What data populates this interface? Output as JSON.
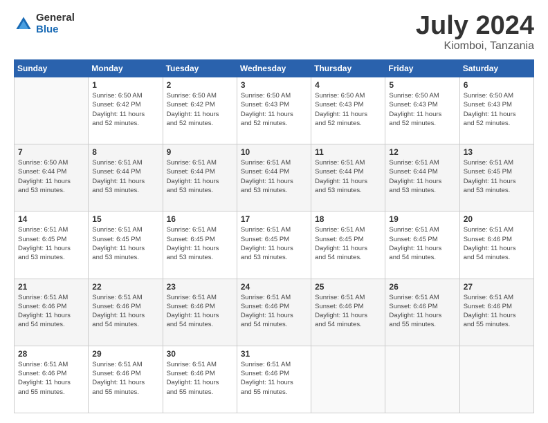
{
  "logo": {
    "general": "General",
    "blue": "Blue"
  },
  "title": {
    "month_year": "July 2024",
    "location": "Kiomboi, Tanzania"
  },
  "weekdays": [
    "Sunday",
    "Monday",
    "Tuesday",
    "Wednesday",
    "Thursday",
    "Friday",
    "Saturday"
  ],
  "weeks": [
    [
      {
        "day": "",
        "info": ""
      },
      {
        "day": "1",
        "info": "Sunrise: 6:50 AM\nSunset: 6:42 PM\nDaylight: 11 hours\nand 52 minutes."
      },
      {
        "day": "2",
        "info": "Sunrise: 6:50 AM\nSunset: 6:42 PM\nDaylight: 11 hours\nand 52 minutes."
      },
      {
        "day": "3",
        "info": "Sunrise: 6:50 AM\nSunset: 6:43 PM\nDaylight: 11 hours\nand 52 minutes."
      },
      {
        "day": "4",
        "info": "Sunrise: 6:50 AM\nSunset: 6:43 PM\nDaylight: 11 hours\nand 52 minutes."
      },
      {
        "day": "5",
        "info": "Sunrise: 6:50 AM\nSunset: 6:43 PM\nDaylight: 11 hours\nand 52 minutes."
      },
      {
        "day": "6",
        "info": "Sunrise: 6:50 AM\nSunset: 6:43 PM\nDaylight: 11 hours\nand 52 minutes."
      }
    ],
    [
      {
        "day": "7",
        "info": "Sunrise: 6:50 AM\nSunset: 6:44 PM\nDaylight: 11 hours\nand 53 minutes."
      },
      {
        "day": "8",
        "info": "Sunrise: 6:51 AM\nSunset: 6:44 PM\nDaylight: 11 hours\nand 53 minutes."
      },
      {
        "day": "9",
        "info": "Sunrise: 6:51 AM\nSunset: 6:44 PM\nDaylight: 11 hours\nand 53 minutes."
      },
      {
        "day": "10",
        "info": "Sunrise: 6:51 AM\nSunset: 6:44 PM\nDaylight: 11 hours\nand 53 minutes."
      },
      {
        "day": "11",
        "info": "Sunrise: 6:51 AM\nSunset: 6:44 PM\nDaylight: 11 hours\nand 53 minutes."
      },
      {
        "day": "12",
        "info": "Sunrise: 6:51 AM\nSunset: 6:44 PM\nDaylight: 11 hours\nand 53 minutes."
      },
      {
        "day": "13",
        "info": "Sunrise: 6:51 AM\nSunset: 6:45 PM\nDaylight: 11 hours\nand 53 minutes."
      }
    ],
    [
      {
        "day": "14",
        "info": "Sunrise: 6:51 AM\nSunset: 6:45 PM\nDaylight: 11 hours\nand 53 minutes."
      },
      {
        "day": "15",
        "info": "Sunrise: 6:51 AM\nSunset: 6:45 PM\nDaylight: 11 hours\nand 53 minutes."
      },
      {
        "day": "16",
        "info": "Sunrise: 6:51 AM\nSunset: 6:45 PM\nDaylight: 11 hours\nand 53 minutes."
      },
      {
        "day": "17",
        "info": "Sunrise: 6:51 AM\nSunset: 6:45 PM\nDaylight: 11 hours\nand 53 minutes."
      },
      {
        "day": "18",
        "info": "Sunrise: 6:51 AM\nSunset: 6:45 PM\nDaylight: 11 hours\nand 54 minutes."
      },
      {
        "day": "19",
        "info": "Sunrise: 6:51 AM\nSunset: 6:45 PM\nDaylight: 11 hours\nand 54 minutes."
      },
      {
        "day": "20",
        "info": "Sunrise: 6:51 AM\nSunset: 6:46 PM\nDaylight: 11 hours\nand 54 minutes."
      }
    ],
    [
      {
        "day": "21",
        "info": "Sunrise: 6:51 AM\nSunset: 6:46 PM\nDaylight: 11 hours\nand 54 minutes."
      },
      {
        "day": "22",
        "info": "Sunrise: 6:51 AM\nSunset: 6:46 PM\nDaylight: 11 hours\nand 54 minutes."
      },
      {
        "day": "23",
        "info": "Sunrise: 6:51 AM\nSunset: 6:46 PM\nDaylight: 11 hours\nand 54 minutes."
      },
      {
        "day": "24",
        "info": "Sunrise: 6:51 AM\nSunset: 6:46 PM\nDaylight: 11 hours\nand 54 minutes."
      },
      {
        "day": "25",
        "info": "Sunrise: 6:51 AM\nSunset: 6:46 PM\nDaylight: 11 hours\nand 54 minutes."
      },
      {
        "day": "26",
        "info": "Sunrise: 6:51 AM\nSunset: 6:46 PM\nDaylight: 11 hours\nand 55 minutes."
      },
      {
        "day": "27",
        "info": "Sunrise: 6:51 AM\nSunset: 6:46 PM\nDaylight: 11 hours\nand 55 minutes."
      }
    ],
    [
      {
        "day": "28",
        "info": "Sunrise: 6:51 AM\nSunset: 6:46 PM\nDaylight: 11 hours\nand 55 minutes."
      },
      {
        "day": "29",
        "info": "Sunrise: 6:51 AM\nSunset: 6:46 PM\nDaylight: 11 hours\nand 55 minutes."
      },
      {
        "day": "30",
        "info": "Sunrise: 6:51 AM\nSunset: 6:46 PM\nDaylight: 11 hours\nand 55 minutes."
      },
      {
        "day": "31",
        "info": "Sunrise: 6:51 AM\nSunset: 6:46 PM\nDaylight: 11 hours\nand 55 minutes."
      },
      {
        "day": "",
        "info": ""
      },
      {
        "day": "",
        "info": ""
      },
      {
        "day": "",
        "info": ""
      }
    ]
  ]
}
